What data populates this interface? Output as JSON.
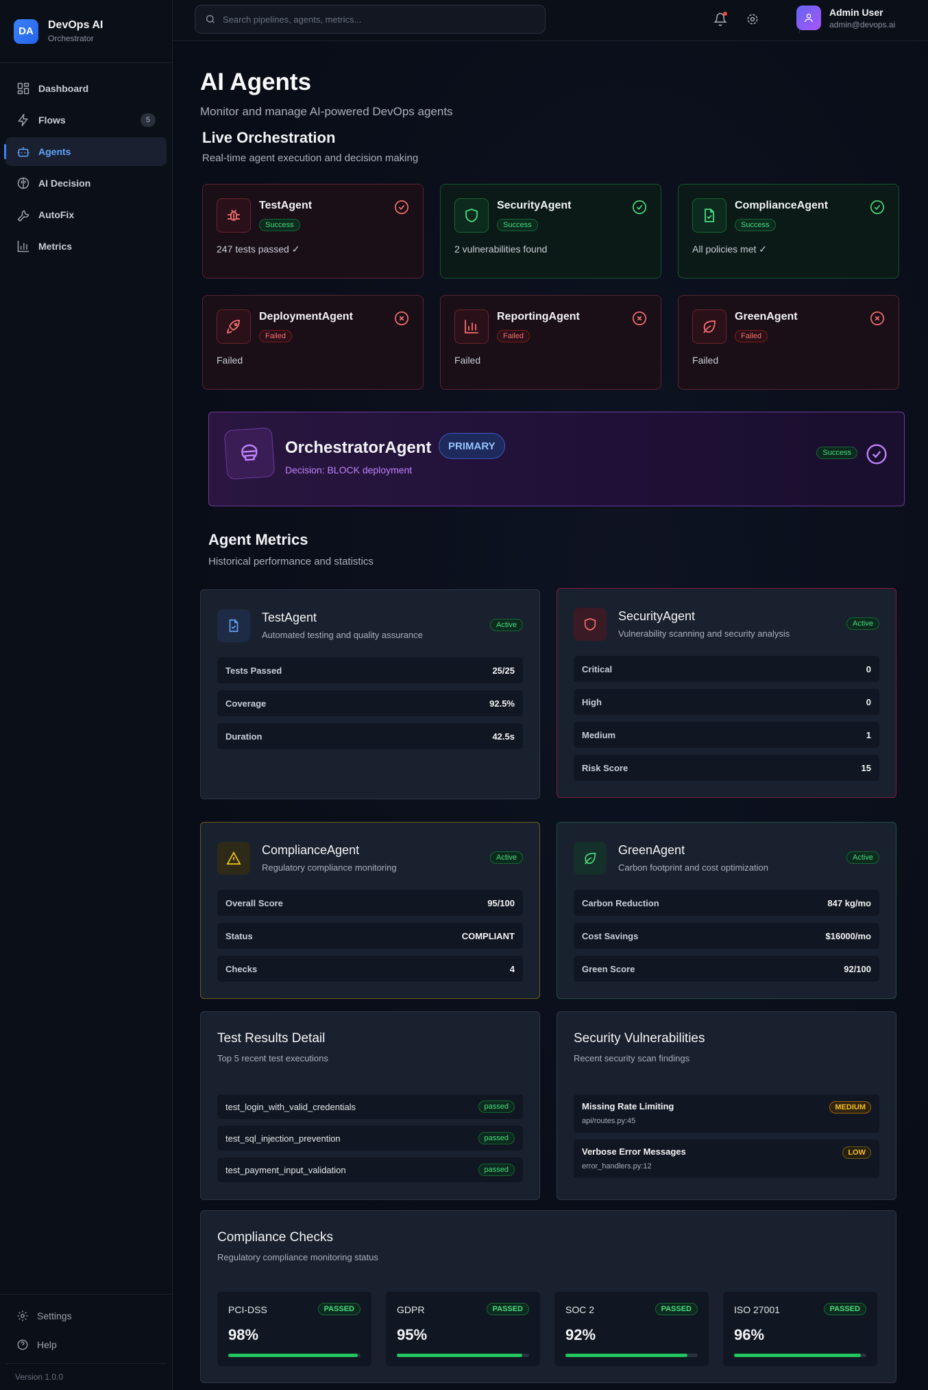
{
  "brand": {
    "initials": "DA",
    "name": "DevOps AI",
    "subtitle": "Orchestrator"
  },
  "nav": [
    {
      "label": "Dashboard",
      "icon": "dashboard-icon"
    },
    {
      "label": "Flows",
      "icon": "zap-icon",
      "badge": "5"
    },
    {
      "label": "Agents",
      "icon": "bot-icon",
      "active": true
    },
    {
      "label": "AI Decision",
      "icon": "brain-icon"
    },
    {
      "label": "AutoFix",
      "icon": "wrench-icon"
    },
    {
      "label": "Metrics",
      "icon": "bar-chart-icon"
    }
  ],
  "sidebar_bottom": {
    "settings": "Settings",
    "help": "Help",
    "version": "Version 1.0.0"
  },
  "header": {
    "search_placeholder": "Search pipelines, agents, metrics...",
    "user_name": "Admin User",
    "user_email": "admin@devops.ai"
  },
  "page": {
    "title": "AI Agents",
    "subtitle": "Monitor and manage AI-powered DevOps agents"
  },
  "live": {
    "title": "Live Orchestration",
    "subtitle": "Real-time agent execution and decision making",
    "agents": [
      {
        "name": "TestAgent",
        "status": "Success",
        "desc": "247 tests passed ✓",
        "icon": "bug-icon"
      },
      {
        "name": "SecurityAgent",
        "status": "Success",
        "desc": "2 vulnerabilities found",
        "icon": "shield-icon"
      },
      {
        "name": "ComplianceAgent",
        "status": "Success",
        "desc": "All policies met ✓",
        "icon": "file-check-icon"
      },
      {
        "name": "DeploymentAgent",
        "status": "Failed",
        "desc": "Failed",
        "icon": "rocket-icon"
      },
      {
        "name": "ReportingAgent",
        "status": "Failed",
        "desc": "Failed",
        "icon": "bar-chart-icon"
      },
      {
        "name": "GreenAgent",
        "status": "Failed",
        "desc": "Failed",
        "icon": "leaf-icon"
      }
    ]
  },
  "orchestrator": {
    "name": "OrchestratorAgent",
    "tag": "PRIMARY",
    "decision": "Decision: BLOCK deployment",
    "status": "Success"
  },
  "metrics": {
    "title": "Agent Metrics",
    "subtitle": "Historical performance and statistics",
    "cards": [
      {
        "name": "TestAgent",
        "desc": "Automated testing and quality assurance",
        "status": "Active",
        "rows": [
          {
            "k": "Tests Passed",
            "v": "25/25"
          },
          {
            "k": "Coverage",
            "v": "92.5%"
          },
          {
            "k": "Duration",
            "v": "42.5s"
          }
        ]
      },
      {
        "name": "SecurityAgent",
        "desc": "Vulnerability scanning and security analysis",
        "status": "Active",
        "rows": [
          {
            "k": "Critical",
            "v": "0"
          },
          {
            "k": "High",
            "v": "0"
          },
          {
            "k": "Medium",
            "v": "1"
          },
          {
            "k": "Risk Score",
            "v": "15"
          }
        ]
      },
      {
        "name": "ComplianceAgent",
        "desc": "Regulatory compliance monitoring",
        "status": "Active",
        "rows": [
          {
            "k": "Overall Score",
            "v": "95/100"
          },
          {
            "k": "Status",
            "v": "COMPLIANT"
          },
          {
            "k": "Checks",
            "v": "4"
          }
        ]
      },
      {
        "name": "GreenAgent",
        "desc": "Carbon footprint and cost optimization",
        "status": "Active",
        "rows": [
          {
            "k": "Carbon Reduction",
            "v": "847 kg/mo"
          },
          {
            "k": "Cost Savings",
            "v": "$16000/mo"
          },
          {
            "k": "Green Score",
            "v": "92/100"
          }
        ]
      }
    ]
  },
  "tests": {
    "title": "Test Results Detail",
    "subtitle": "Top 5 recent test executions",
    "items": [
      {
        "name": "test_login_with_valid_credentials",
        "status": "passed"
      },
      {
        "name": "test_sql_injection_prevention",
        "status": "passed"
      },
      {
        "name": "test_payment_input_validation",
        "status": "passed"
      }
    ]
  },
  "vulns": {
    "title": "Security Vulnerabilities",
    "subtitle": "Recent security scan findings",
    "items": [
      {
        "title": "Missing Rate Limiting",
        "file": "api/routes.py:45",
        "severity": "MEDIUM"
      },
      {
        "title": "Verbose Error Messages",
        "file": "error_handlers.py:12",
        "severity": "LOW"
      }
    ]
  },
  "compliance": {
    "title": "Compliance Checks",
    "subtitle": "Regulatory compliance monitoring status",
    "items": [
      {
        "name": "PCI-DSS",
        "status": "PASSED",
        "score": "98%",
        "progress": 0.98
      },
      {
        "name": "GDPR",
        "status": "PASSED",
        "score": "95%",
        "progress": 0.95
      },
      {
        "name": "SOC 2",
        "status": "PASSED",
        "score": "92%",
        "progress": 0.92
      },
      {
        "name": "ISO 27001",
        "status": "PASSED",
        "score": "96%",
        "progress": 0.96
      }
    ]
  },
  "colors": {
    "accent": "#3b82f6",
    "success": "#22c55e",
    "danger": "#ef4444",
    "purple": "#a855f7",
    "warning": "#eab308"
  }
}
